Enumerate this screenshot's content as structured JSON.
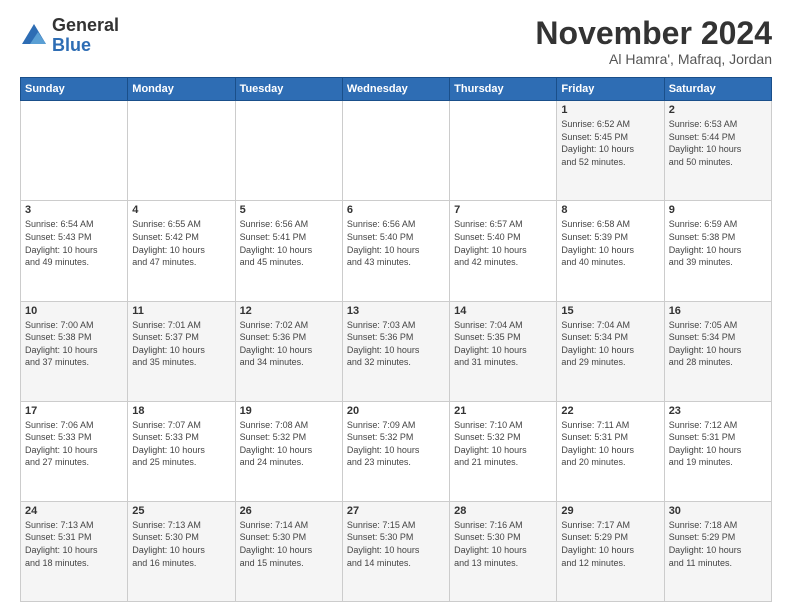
{
  "logo": {
    "general": "General",
    "blue": "Blue"
  },
  "header": {
    "month": "November 2024",
    "location": "Al Hamra', Mafraq, Jordan"
  },
  "weekdays": [
    "Sunday",
    "Monday",
    "Tuesday",
    "Wednesday",
    "Thursday",
    "Friday",
    "Saturday"
  ],
  "weeks": [
    [
      {
        "day": "",
        "info": ""
      },
      {
        "day": "",
        "info": ""
      },
      {
        "day": "",
        "info": ""
      },
      {
        "day": "",
        "info": ""
      },
      {
        "day": "",
        "info": ""
      },
      {
        "day": "1",
        "info": "Sunrise: 6:52 AM\nSunset: 5:45 PM\nDaylight: 10 hours\nand 52 minutes."
      },
      {
        "day": "2",
        "info": "Sunrise: 6:53 AM\nSunset: 5:44 PM\nDaylight: 10 hours\nand 50 minutes."
      }
    ],
    [
      {
        "day": "3",
        "info": "Sunrise: 6:54 AM\nSunset: 5:43 PM\nDaylight: 10 hours\nand 49 minutes."
      },
      {
        "day": "4",
        "info": "Sunrise: 6:55 AM\nSunset: 5:42 PM\nDaylight: 10 hours\nand 47 minutes."
      },
      {
        "day": "5",
        "info": "Sunrise: 6:56 AM\nSunset: 5:41 PM\nDaylight: 10 hours\nand 45 minutes."
      },
      {
        "day": "6",
        "info": "Sunrise: 6:56 AM\nSunset: 5:40 PM\nDaylight: 10 hours\nand 43 minutes."
      },
      {
        "day": "7",
        "info": "Sunrise: 6:57 AM\nSunset: 5:40 PM\nDaylight: 10 hours\nand 42 minutes."
      },
      {
        "day": "8",
        "info": "Sunrise: 6:58 AM\nSunset: 5:39 PM\nDaylight: 10 hours\nand 40 minutes."
      },
      {
        "day": "9",
        "info": "Sunrise: 6:59 AM\nSunset: 5:38 PM\nDaylight: 10 hours\nand 39 minutes."
      }
    ],
    [
      {
        "day": "10",
        "info": "Sunrise: 7:00 AM\nSunset: 5:38 PM\nDaylight: 10 hours\nand 37 minutes."
      },
      {
        "day": "11",
        "info": "Sunrise: 7:01 AM\nSunset: 5:37 PM\nDaylight: 10 hours\nand 35 minutes."
      },
      {
        "day": "12",
        "info": "Sunrise: 7:02 AM\nSunset: 5:36 PM\nDaylight: 10 hours\nand 34 minutes."
      },
      {
        "day": "13",
        "info": "Sunrise: 7:03 AM\nSunset: 5:36 PM\nDaylight: 10 hours\nand 32 minutes."
      },
      {
        "day": "14",
        "info": "Sunrise: 7:04 AM\nSunset: 5:35 PM\nDaylight: 10 hours\nand 31 minutes."
      },
      {
        "day": "15",
        "info": "Sunrise: 7:04 AM\nSunset: 5:34 PM\nDaylight: 10 hours\nand 29 minutes."
      },
      {
        "day": "16",
        "info": "Sunrise: 7:05 AM\nSunset: 5:34 PM\nDaylight: 10 hours\nand 28 minutes."
      }
    ],
    [
      {
        "day": "17",
        "info": "Sunrise: 7:06 AM\nSunset: 5:33 PM\nDaylight: 10 hours\nand 27 minutes."
      },
      {
        "day": "18",
        "info": "Sunrise: 7:07 AM\nSunset: 5:33 PM\nDaylight: 10 hours\nand 25 minutes."
      },
      {
        "day": "19",
        "info": "Sunrise: 7:08 AM\nSunset: 5:32 PM\nDaylight: 10 hours\nand 24 minutes."
      },
      {
        "day": "20",
        "info": "Sunrise: 7:09 AM\nSunset: 5:32 PM\nDaylight: 10 hours\nand 23 minutes."
      },
      {
        "day": "21",
        "info": "Sunrise: 7:10 AM\nSunset: 5:32 PM\nDaylight: 10 hours\nand 21 minutes."
      },
      {
        "day": "22",
        "info": "Sunrise: 7:11 AM\nSunset: 5:31 PM\nDaylight: 10 hours\nand 20 minutes."
      },
      {
        "day": "23",
        "info": "Sunrise: 7:12 AM\nSunset: 5:31 PM\nDaylight: 10 hours\nand 19 minutes."
      }
    ],
    [
      {
        "day": "24",
        "info": "Sunrise: 7:13 AM\nSunset: 5:31 PM\nDaylight: 10 hours\nand 18 minutes."
      },
      {
        "day": "25",
        "info": "Sunrise: 7:13 AM\nSunset: 5:30 PM\nDaylight: 10 hours\nand 16 minutes."
      },
      {
        "day": "26",
        "info": "Sunrise: 7:14 AM\nSunset: 5:30 PM\nDaylight: 10 hours\nand 15 minutes."
      },
      {
        "day": "27",
        "info": "Sunrise: 7:15 AM\nSunset: 5:30 PM\nDaylight: 10 hours\nand 14 minutes."
      },
      {
        "day": "28",
        "info": "Sunrise: 7:16 AM\nSunset: 5:30 PM\nDaylight: 10 hours\nand 13 minutes."
      },
      {
        "day": "29",
        "info": "Sunrise: 7:17 AM\nSunset: 5:29 PM\nDaylight: 10 hours\nand 12 minutes."
      },
      {
        "day": "30",
        "info": "Sunrise: 7:18 AM\nSunset: 5:29 PM\nDaylight: 10 hours\nand 11 minutes."
      }
    ]
  ]
}
